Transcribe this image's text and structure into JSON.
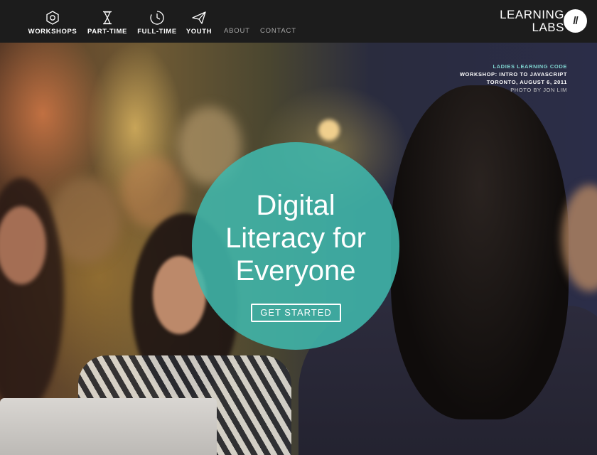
{
  "nav": {
    "items": [
      {
        "label": "WORKSHOPS",
        "icon": "hexagon-icon"
      },
      {
        "label": "PART-TIME",
        "icon": "hourglass-icon"
      },
      {
        "label": "FULL-TIME",
        "icon": "clock-icon"
      },
      {
        "label": "YOUTH",
        "icon": "paper-plane-icon"
      }
    ],
    "links": [
      "ABOUT",
      "CONTACT"
    ]
  },
  "brand": {
    "line1": "LEARNING",
    "line2": "LABS",
    "mark": "//"
  },
  "credit": {
    "org": "LADIES LEARNING CODE",
    "event": "WORKSHOP: INTRO TO JAVASCRIPT",
    "place": "TORONTO, AUGUST 6, 2011",
    "photo": "PHOTO BY JON LIM"
  },
  "hero": {
    "headline_lines": [
      "Digital",
      "Literacy for",
      "Everyone"
    ],
    "cta": "GET STARTED"
  },
  "colors": {
    "accent": "#40b7ac",
    "nav_bg": "#1c1c1c",
    "credit_accent": "#7ed3cf"
  }
}
